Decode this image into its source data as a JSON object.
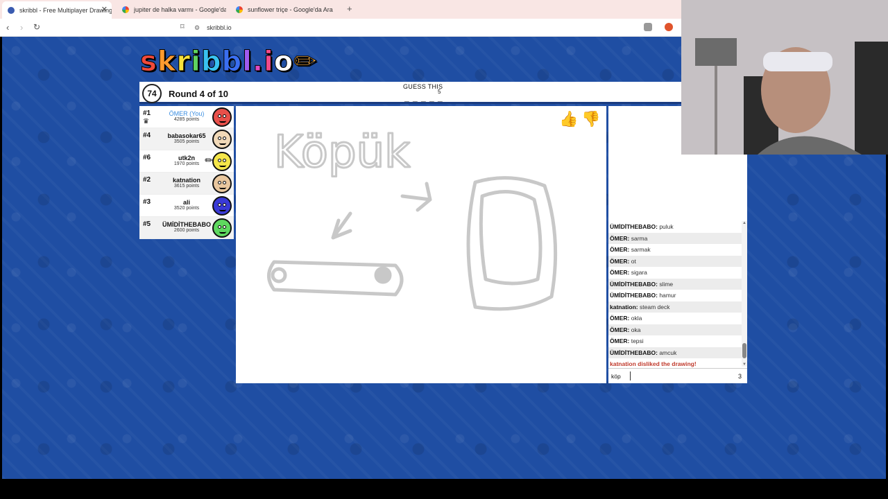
{
  "browser": {
    "tabs": [
      {
        "title": "skribbl - Free Multiplayer Drawing",
        "active": true
      },
      {
        "title": "jupiter de halka varmı - Google'da Ara",
        "active": false
      },
      {
        "title": "sunflower triçe - Google'da Ara",
        "active": false
      }
    ],
    "url": "skribbl.io"
  },
  "game": {
    "logo": "skribbl.io",
    "timer": "74",
    "round": "Round 4 of 10",
    "guess_label": "GUESS THIS",
    "word_hint": "_ _ _ _ _",
    "word_length": "5"
  },
  "players": [
    {
      "rank": "#1",
      "name": "ÖMER (You)",
      "points": "4285 points",
      "you": true,
      "crown": true,
      "color": "#e8504a"
    },
    {
      "rank": "#4",
      "name": "babasokar65",
      "points": "3505 points",
      "you": false,
      "crown": false,
      "color": "#f1d9b8"
    },
    {
      "rank": "#6",
      "name": "utk2n",
      "points": "1970 points",
      "you": false,
      "crown": false,
      "color": "#f5e64a"
    },
    {
      "rank": "#2",
      "name": "katnation",
      "points": "3615 points",
      "you": false,
      "crown": false,
      "color": "#e9c79e"
    },
    {
      "rank": "#3",
      "name": "ali",
      "points": "3520 points",
      "you": false,
      "crown": false,
      "color": "#3a3ad6"
    },
    {
      "rank": "#5",
      "name": "ÜMİDİTHEBABO",
      "points": "2600 points",
      "you": false,
      "crown": false,
      "color": "#5fd85f"
    }
  ],
  "drawing": {
    "text": "Köpük"
  },
  "chat": {
    "messages": [
      {
        "user": "ÜMİDİTHEBABO:",
        "text": "puluk"
      },
      {
        "user": "ÖMER:",
        "text": "sarma"
      },
      {
        "user": "ÖMER:",
        "text": "sarmak"
      },
      {
        "user": "ÖMER:",
        "text": "ot"
      },
      {
        "user": "ÖMER:",
        "text": "sigara"
      },
      {
        "user": "ÜMİDİTHEBABO:",
        "text": "slime"
      },
      {
        "user": "ÜMİDİTHEBABO:",
        "text": "hamur"
      },
      {
        "user": "katnation:",
        "text": "steam deck"
      },
      {
        "user": "ÖMER:",
        "text": "okla"
      },
      {
        "user": "ÖMER:",
        "text": "oka"
      },
      {
        "user": "ÖMER:",
        "text": "tepsi"
      },
      {
        "user": "ÜMİDİTHEBABO:",
        "text": "amcuk"
      }
    ],
    "system_message": "katnation disliked the drawing!",
    "input_value": "köp",
    "input_count": "3"
  }
}
